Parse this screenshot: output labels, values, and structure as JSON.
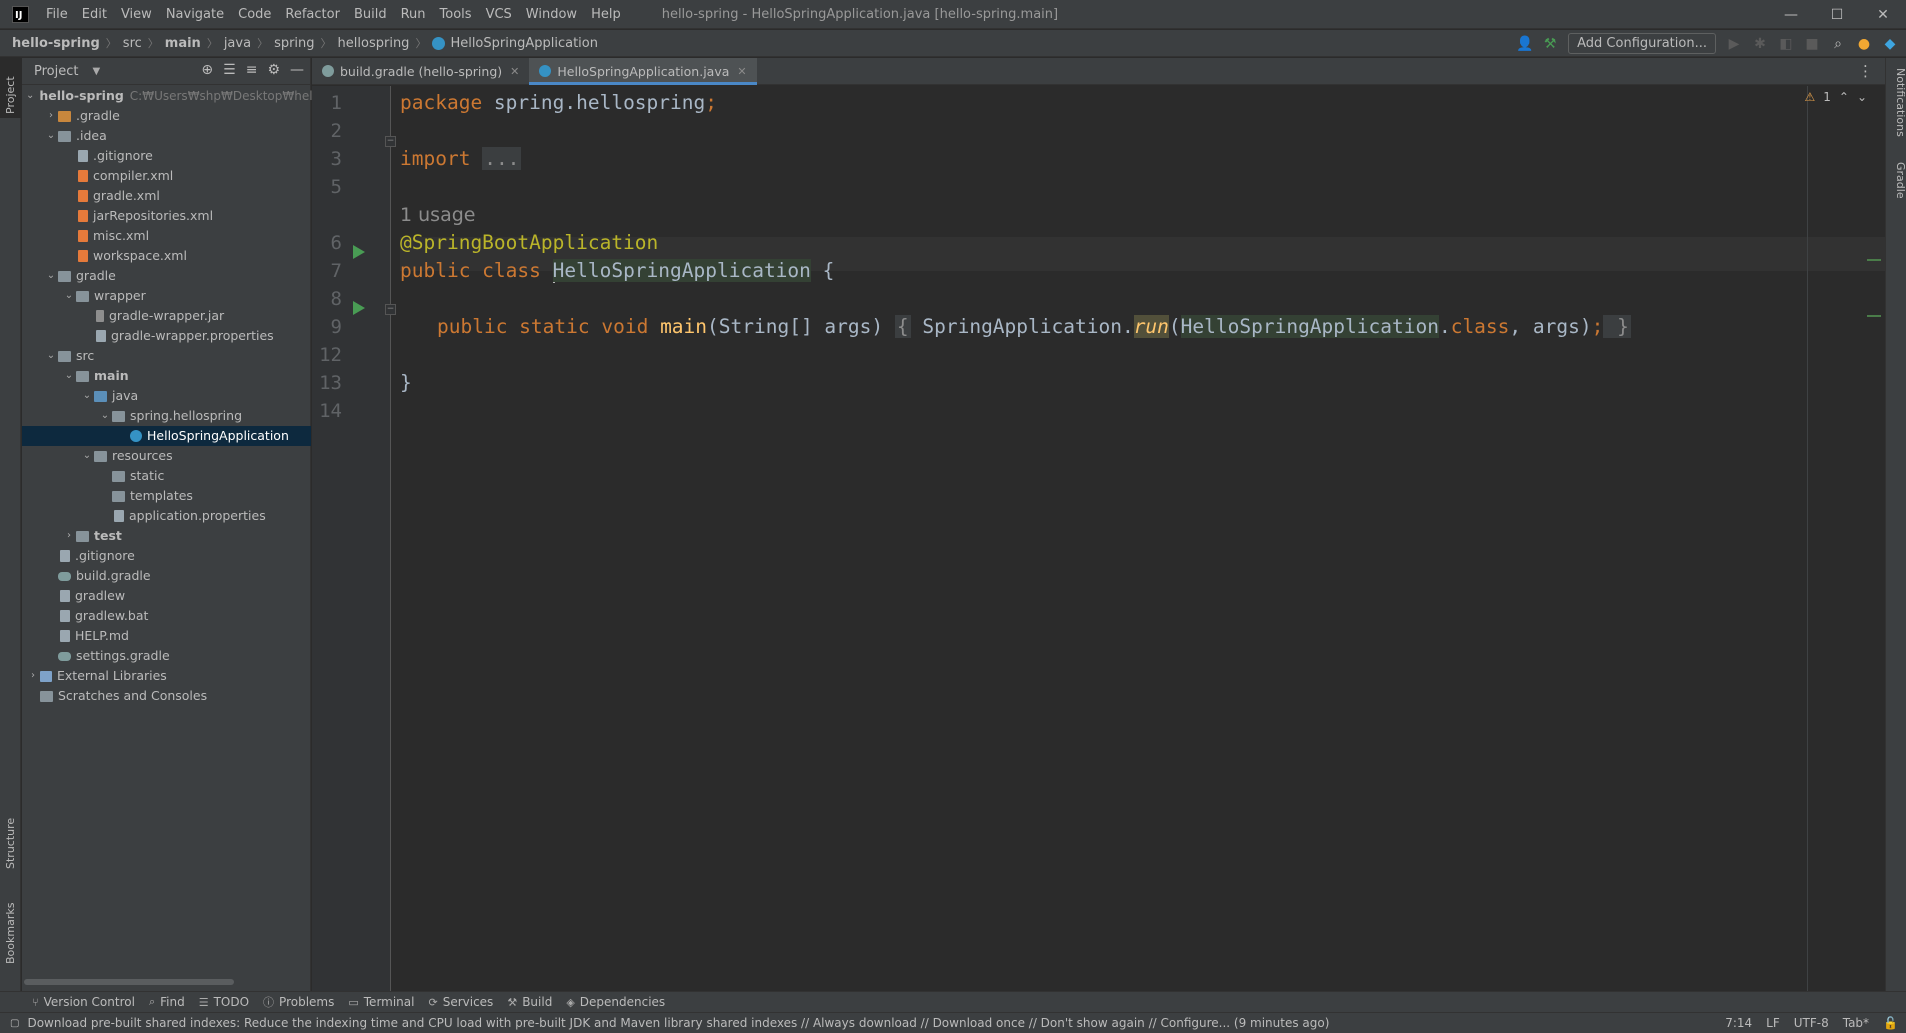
{
  "titlebar": {
    "logo": "IJ",
    "menu": [
      "File",
      "Edit",
      "View",
      "Navigate",
      "Code",
      "Refactor",
      "Build",
      "Run",
      "Tools",
      "VCS",
      "Window",
      "Help"
    ],
    "title": "hello-spring - HelloSpringApplication.java [hello-spring.main]",
    "controls": {
      "minimize": "—",
      "maximize": "☐",
      "close": "✕"
    }
  },
  "breadcrumb": [
    "hello-spring",
    "src",
    "main",
    "java",
    "spring",
    "hellospring",
    "HelloSpringApplication"
  ],
  "navbar": {
    "add_configuration": "Add Configuration..."
  },
  "project_panel": {
    "title": "Project",
    "tree": [
      {
        "label": "hello-spring",
        "path": "C:₩Users₩shp₩Desktop₩hello-",
        "depth": 0,
        "expanded": true,
        "icon": "folder-icon",
        "bold": true
      },
      {
        "label": ".gradle",
        "depth": 1,
        "expanded": false,
        "icon": "folder-orange-icon"
      },
      {
        "label": ".idea",
        "depth": 1,
        "expanded": true,
        "icon": "folder-icon"
      },
      {
        "label": ".gitignore",
        "depth": 2,
        "icon": "file-icon"
      },
      {
        "label": "compiler.xml",
        "depth": 2,
        "icon": "xml-icon"
      },
      {
        "label": "gradle.xml",
        "depth": 2,
        "icon": "xml-icon"
      },
      {
        "label": "jarRepositories.xml",
        "depth": 2,
        "icon": "xml-icon"
      },
      {
        "label": "misc.xml",
        "depth": 2,
        "icon": "xml-icon"
      },
      {
        "label": "workspace.xml",
        "depth": 2,
        "icon": "xml-icon"
      },
      {
        "label": "gradle",
        "depth": 1,
        "expanded": true,
        "icon": "folder-icon"
      },
      {
        "label": "wrapper",
        "depth": 2,
        "expanded": true,
        "icon": "folder-icon"
      },
      {
        "label": "gradle-wrapper.jar",
        "depth": 3,
        "icon": "jar-icon"
      },
      {
        "label": "gradle-wrapper.properties",
        "depth": 3,
        "icon": "file-icon"
      },
      {
        "label": "src",
        "depth": 1,
        "expanded": true,
        "icon": "folder-icon"
      },
      {
        "label": "main",
        "depth": 2,
        "expanded": true,
        "icon": "folder-icon",
        "bold": true
      },
      {
        "label": "java",
        "depth": 3,
        "expanded": true,
        "icon": "folder-blue-icon"
      },
      {
        "label": "spring.hellospring",
        "depth": 4,
        "expanded": true,
        "icon": "folder-icon"
      },
      {
        "label": "HelloSpringApplication",
        "depth": 5,
        "icon": "class-icon",
        "selected": true
      },
      {
        "label": "resources",
        "depth": 3,
        "expanded": true,
        "icon": "folder-icon"
      },
      {
        "label": "static",
        "depth": 4,
        "icon": "folder-icon"
      },
      {
        "label": "templates",
        "depth": 4,
        "icon": "folder-icon"
      },
      {
        "label": "application.properties",
        "depth": 4,
        "icon": "file-icon"
      },
      {
        "label": "test",
        "depth": 2,
        "expanded": false,
        "icon": "folder-icon",
        "bold": true
      },
      {
        "label": ".gitignore",
        "depth": 1,
        "icon": "file-icon"
      },
      {
        "label": "build.gradle",
        "depth": 1,
        "icon": "gradle-icon"
      },
      {
        "label": "gradlew",
        "depth": 1,
        "icon": "file-icon"
      },
      {
        "label": "gradlew.bat",
        "depth": 1,
        "icon": "file-icon"
      },
      {
        "label": "HELP.md",
        "depth": 1,
        "icon": "file-icon"
      },
      {
        "label": "settings.gradle",
        "depth": 1,
        "icon": "gradle-icon"
      },
      {
        "label": "External Libraries",
        "depth": 0,
        "expanded": false,
        "icon": "library-icon"
      },
      {
        "label": "Scratches and Consoles",
        "depth": 0,
        "icon": "scratch-icon"
      }
    ]
  },
  "left_stripe": {
    "project": "Project",
    "structure": "Structure",
    "bookmarks": "Bookmarks"
  },
  "right_stripe": {
    "notifications": "Notifications",
    "gradle": "Gradle"
  },
  "tabs": [
    {
      "label": "build.gradle (hello-spring)",
      "active": false,
      "icon": "gradle-icon"
    },
    {
      "label": "HelloSpringApplication.java",
      "active": true,
      "icon": "class-icon"
    }
  ],
  "editor": {
    "warnings": "1",
    "line_numbers": [
      "1",
      "2",
      "3",
      "5",
      "",
      "6",
      "7",
      "8",
      "9",
      "12",
      "13",
      "14"
    ],
    "code": {
      "l1_kw": "package",
      "l1_rest": " spring.hellospring",
      "l1_semi": ";",
      "l3_kw": "import",
      "l3_fold": "...",
      "usage": "1 usage",
      "l6": "@SpringBootApplication",
      "l7_kw": "public class ",
      "l7_name": "HelloSpringApplication",
      "l7_brace": " {",
      "l9_kw": "public static void ",
      "l9_fn": "main",
      "l9_sig": "(String[] args) ",
      "l9_open": "{",
      "l9_call": " SpringApplication.",
      "l9_run": "run",
      "l9_paren": "(",
      "l9_cls": "HelloSpringApplication",
      "l9_dot": ".",
      "l9_class_kw": "class",
      "l9_args": ", args)",
      "l9_semi": ";",
      "l9_close": " }",
      "l13": "}"
    }
  },
  "bottom_tools": [
    "Version Control",
    "Find",
    "TODO",
    "Problems",
    "Terminal",
    "Services",
    "Build",
    "Dependencies"
  ],
  "status": {
    "message": "Download pre-built shared indexes: Reduce the indexing time and CPU load with pre-built JDK and Maven library shared indexes // Always download // Download once // Don't show again // Configure... (9 minutes ago)",
    "position": "7:14",
    "line_sep": "LF",
    "encoding": "UTF-8",
    "indent": "Tab*"
  },
  "colors": {
    "keyword": "#cc7832",
    "annotation": "#bbb529",
    "function": "#ffc66d",
    "text": "#a9b7c6",
    "selection": "#0d293e",
    "run_icon": "#499c54"
  }
}
